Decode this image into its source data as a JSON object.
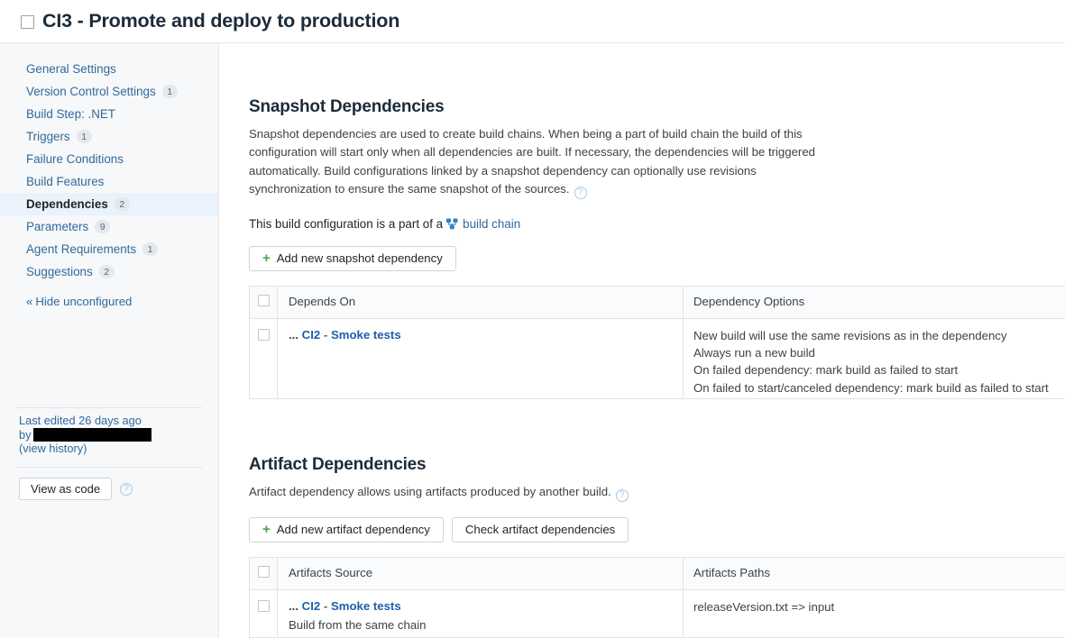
{
  "header": {
    "checkbox_icon": "unchecked-square",
    "title": "CI3 - Promote and deploy to production"
  },
  "sidebar": {
    "items": [
      {
        "label": "General Settings",
        "badge": "",
        "selected": false
      },
      {
        "label": "Version Control Settings",
        "badge": "1",
        "selected": false
      },
      {
        "label": "Build Step: .NET",
        "badge": "",
        "selected": false
      },
      {
        "label": "Triggers",
        "badge": "1",
        "selected": false
      },
      {
        "label": "Failure Conditions",
        "badge": "",
        "selected": false
      },
      {
        "label": "Build Features",
        "badge": "",
        "selected": false
      },
      {
        "label": "Dependencies",
        "badge": "2",
        "selected": true
      },
      {
        "label": "Parameters",
        "badge": "9",
        "selected": false
      },
      {
        "label": "Agent Requirements",
        "badge": "1",
        "selected": false
      },
      {
        "label": "Suggestions",
        "badge": "2",
        "selected": false
      }
    ],
    "hide_unconfigured": "Hide unconfigured",
    "chevron": "«",
    "meta": {
      "last_edited": "Last edited 26 days ago",
      "by_label": "by",
      "by_value_redacted": "",
      "view_history": "(view history)"
    },
    "view_as_code": "View as code",
    "help_icon": "?"
  },
  "snapshot": {
    "title": "Snapshot Dependencies",
    "description": "Snapshot dependencies are used to create build chains. When being a part of build chain the build of this configuration will start only when all dependencies are built. If necessary, the dependencies will be triggered automatically. Build configurations linked by a snapshot dependency can optionally use revisions synchronization to ensure the same snapshot of the sources.",
    "help_icon": "?",
    "chain_prefix": "This build configuration is a part of a",
    "chain_icon": "build-chain-icon",
    "chain_link": "build chain",
    "add_button": "Add new snapshot dependency",
    "plus": "+",
    "columns": [
      "Depends On",
      "Dependency Options"
    ],
    "rows": [
      {
        "dots": "...",
        "name": "CI2",
        "dash": "-",
        "suffix": "Smoke tests",
        "options": [
          "New build will use the same revisions as in the dependency",
          "Always run a new build",
          "On failed dependency: mark build as failed to start",
          "On failed to start/canceled dependency: mark build as failed to start"
        ]
      }
    ]
  },
  "artifact": {
    "title": "Artifact Dependencies",
    "description": "Artifact dependency allows using artifacts produced by another build.",
    "help_icon": "?",
    "add_button": "Add new artifact dependency",
    "check_button": "Check artifact dependencies",
    "plus": "+",
    "columns": [
      "Artifacts Source",
      "Artifacts Paths"
    ],
    "rows": [
      {
        "dots": "...",
        "name": "CI2",
        "dash": "-",
        "suffix": "Smoke tests",
        "sub": "Build from the same chain",
        "paths": "releaseVersion.txt => input"
      }
    ]
  },
  "colors": {
    "link": "#30699b",
    "accent_blue": "#1c5fa8",
    "selected_bg": "#eaf3fb",
    "sidebar_bg": "#f7f8fa",
    "plus_green": "#4aa34a",
    "border": "#e0e3e6"
  }
}
